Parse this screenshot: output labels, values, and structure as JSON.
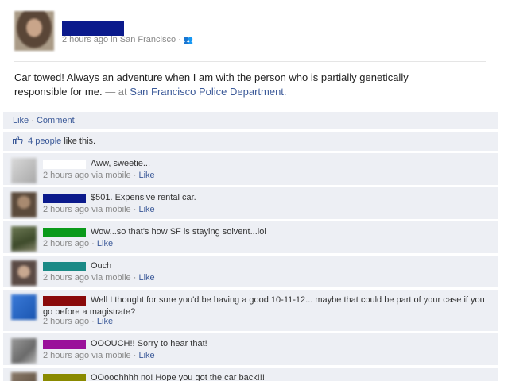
{
  "post": {
    "meta": "2 hours ago in San Francisco ·",
    "audience_icon": "friends-icon",
    "text": "Car towed! Always an adventure when I am with the person who is partially genetically responsible for me.",
    "location_prefix": "— at",
    "location": "San Francisco Police Department."
  },
  "actions": {
    "like": "Like",
    "separator": "·",
    "comment": "Comment"
  },
  "likes": {
    "count": "4 people",
    "suffix": "like this."
  },
  "colors": {
    "link": "#3b5998",
    "panel": "#edeff4",
    "name_redactions": [
      "#ffffff",
      "#0b1a8c",
      "#0a9a1a",
      "#1b8a86",
      "#8a0a0a",
      "#9a109a",
      "#8a8a00"
    ]
  },
  "comments": [
    {
      "text": "Aww, sweetie...",
      "time": "2 hours ago via mobile",
      "like": "Like"
    },
    {
      "text": "$501. Expensive rental car.",
      "time": "2 hours ago via mobile",
      "like": "Like"
    },
    {
      "text": "Wow...so that's how SF is staying solvent...lol",
      "time": "2 hours ago",
      "like": "Like"
    },
    {
      "text": "Ouch",
      "time": "2 hours ago via mobile",
      "like": "Like"
    },
    {
      "text": "Well I thought for sure you'd be having a good 10-11-12... maybe that could be part of your case if you go before a magistrate?",
      "time": "2 hours ago",
      "like": "Like"
    },
    {
      "text": "OOOUCH!! Sorry to hear that!",
      "time": "2 hours ago via mobile",
      "like": "Like"
    },
    {
      "text": "OOooohhhh no! Hope you got the car back!!!",
      "time": "",
      "like": ""
    }
  ],
  "sep": "·"
}
